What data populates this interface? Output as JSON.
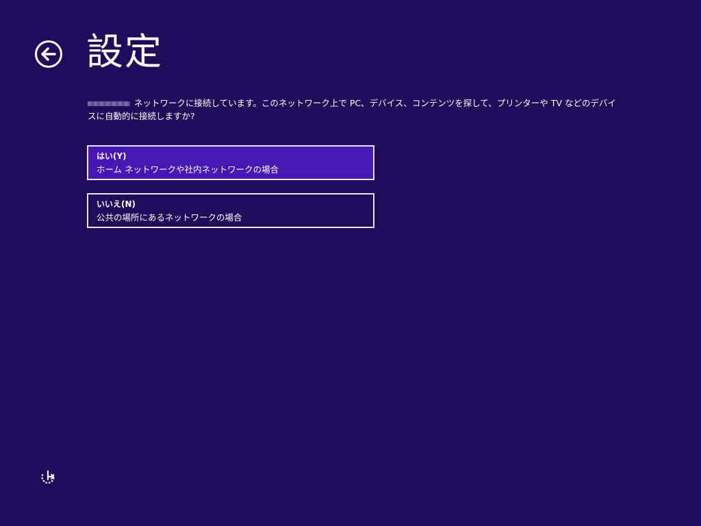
{
  "header": {
    "title": "設定",
    "back_icon": "back-arrow-circle-icon"
  },
  "description": {
    "text": "ネットワークに接続しています。このネットワーク上で PC、デバイス、コンテンツを探して、プリンターや TV などのデバイスに自動的に接続しますか?"
  },
  "options": [
    {
      "label": "はい(Y)",
      "description": "ホーム ネットワークや社内ネットワークの場合",
      "selected": true
    },
    {
      "label": "いいえ(N)",
      "description": "公共の場所にあるネットワークの場合",
      "selected": false
    }
  ],
  "footer": {
    "ease_of_access_icon": "ease-of-access-icon"
  },
  "colors": {
    "background": "#1f0c5a",
    "selected_option": "#4617b4",
    "border": "#e9e6f3",
    "text": "#ffffff"
  }
}
